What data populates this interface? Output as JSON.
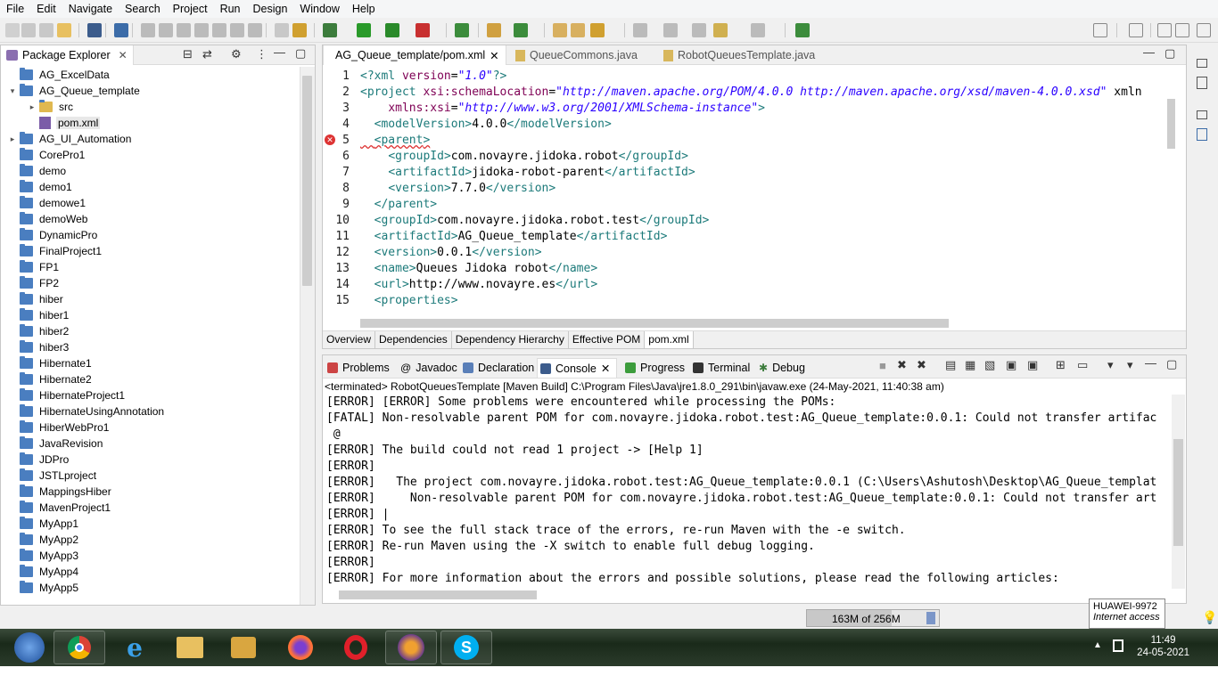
{
  "menu": [
    "File",
    "Edit",
    "Navigate",
    "Search",
    "Project",
    "Run",
    "Design",
    "Window",
    "Help"
  ],
  "package_explorer": {
    "title": "Package Explorer",
    "items": [
      {
        "label": "AG_ExcelData",
        "indent": 0,
        "arrow": ""
      },
      {
        "label": "AG_Queue_template",
        "indent": 0,
        "arrow": "▾"
      },
      {
        "label": "src",
        "indent": 1,
        "arrow": "▸"
      },
      {
        "label": "pom.xml",
        "indent": 1,
        "arrow": "",
        "file": true
      },
      {
        "label": "AG_UI_Automation",
        "indent": 0,
        "arrow": "▸"
      },
      {
        "label": "CorePro1",
        "indent": 0,
        "arrow": ""
      },
      {
        "label": "demo",
        "indent": 0,
        "arrow": ""
      },
      {
        "label": "demo1",
        "indent": 0,
        "arrow": ""
      },
      {
        "label": "demowe1",
        "indent": 0,
        "arrow": ""
      },
      {
        "label": "demoWeb",
        "indent": 0,
        "arrow": ""
      },
      {
        "label": "DynamicPro",
        "indent": 0,
        "arrow": ""
      },
      {
        "label": "FinalProject1",
        "indent": 0,
        "arrow": ""
      },
      {
        "label": "FP1",
        "indent": 0,
        "arrow": ""
      },
      {
        "label": "FP2",
        "indent": 0,
        "arrow": ""
      },
      {
        "label": "hiber",
        "indent": 0,
        "arrow": ""
      },
      {
        "label": "hiber1",
        "indent": 0,
        "arrow": ""
      },
      {
        "label": "hiber2",
        "indent": 0,
        "arrow": ""
      },
      {
        "label": "hiber3",
        "indent": 0,
        "arrow": ""
      },
      {
        "label": "Hibernate1",
        "indent": 0,
        "arrow": ""
      },
      {
        "label": "Hibernate2",
        "indent": 0,
        "arrow": ""
      },
      {
        "label": "HibernateProject1",
        "indent": 0,
        "arrow": ""
      },
      {
        "label": "HibernateUsingAnnotation",
        "indent": 0,
        "arrow": ""
      },
      {
        "label": "HiberWebPro1",
        "indent": 0,
        "arrow": ""
      },
      {
        "label": "JavaRevision",
        "indent": 0,
        "arrow": ""
      },
      {
        "label": "JDPro",
        "indent": 0,
        "arrow": ""
      },
      {
        "label": "JSTLproject",
        "indent": 0,
        "arrow": ""
      },
      {
        "label": "MappingsHiber",
        "indent": 0,
        "arrow": ""
      },
      {
        "label": "MavenProject1",
        "indent": 0,
        "arrow": ""
      },
      {
        "label": "MyApp1",
        "indent": 0,
        "arrow": ""
      },
      {
        "label": "MyApp2",
        "indent": 0,
        "arrow": ""
      },
      {
        "label": "MyApp3",
        "indent": 0,
        "arrow": ""
      },
      {
        "label": "MyApp4",
        "indent": 0,
        "arrow": ""
      },
      {
        "label": "MyApp5",
        "indent": 0,
        "arrow": ""
      }
    ]
  },
  "editor": {
    "tabs": [
      "AG_Queue_template/pom.xml",
      "QueueCommons.java",
      "RobotQueuesTemplate.java"
    ],
    "lines": [
      {
        "n": "1",
        "text": "<?xml version=\"1.0\"?>"
      },
      {
        "n": "2",
        "text": "<project xsi:schemaLocation=\"http://maven.apache.org/POM/4.0.0 http://maven.apache.org/xsd/maven-4.0.0.xsd\" xmln"
      },
      {
        "n": "3",
        "text": "    xmlns:xsi=\"http://www.w3.org/2001/XMLSchema-instance\">"
      },
      {
        "n": "4",
        "text": "  <modelVersion>4.0.0</modelVersion>"
      },
      {
        "n": "5",
        "text": "  <parent>"
      },
      {
        "n": "6",
        "text": "    <groupId>com.novayre.jidoka.robot</groupId>"
      },
      {
        "n": "7",
        "text": "    <artifactId>jidoka-robot-parent</artifactId>"
      },
      {
        "n": "8",
        "text": "    <version>7.7.0</version>"
      },
      {
        "n": "9",
        "text": "  </parent>"
      },
      {
        "n": "10",
        "text": "  <groupId>com.novayre.jidoka.robot.test</groupId>"
      },
      {
        "n": "11",
        "text": "  <artifactId>AG_Queue_template</artifactId>"
      },
      {
        "n": "12",
        "text": "  <version>0.0.1</version>"
      },
      {
        "n": "13",
        "text": "  <name>Queues Jidoka robot</name>"
      },
      {
        "n": "14",
        "text": "  <url>http://www.novayre.es</url>"
      },
      {
        "n": "15",
        "text": "  <properties>"
      }
    ],
    "bottom_tabs": [
      "Overview",
      "Dependencies",
      "Dependency Hierarchy",
      "Effective POM",
      "pom.xml"
    ]
  },
  "console": {
    "tabs": [
      "Problems",
      "Javadoc",
      "Declaration",
      "Console",
      "Progress",
      "Terminal",
      "Debug"
    ],
    "status": "<terminated> RobotQueuesTemplate [Maven Build] C:\\Program Files\\Java\\jre1.8.0_291\\bin\\javaw.exe (24-May-2021, 11:40:38 am)",
    "lines": [
      "[ERROR] [ERROR] Some problems were encountered while processing the POMs:",
      "[FATAL] Non-resolvable parent POM for com.novayre.jidoka.robot.test:AG_Queue_template:0.0.1: Could not transfer artifac",
      " @",
      "[ERROR] The build could not read 1 project -> [Help 1]",
      "[ERROR]",
      "[ERROR]   The project com.novayre.jidoka.robot.test:AG_Queue_template:0.0.1 (C:\\Users\\Ashutosh\\Desktop\\AG_Queue_templat",
      "[ERROR]     Non-resolvable parent POM for com.novayre.jidoka.robot.test:AG_Queue_template:0.0.1: Could not transfer art",
      "[ERROR] |",
      "[ERROR] To see the full stack trace of the errors, re-run Maven with the -e switch.",
      "[ERROR] Re-run Maven using the -X switch to enable full debug logging.",
      "[ERROR]",
      "[ERROR] For more information about the errors and possible solutions, please read the following articles:"
    ]
  },
  "status": {
    "heap": "163M of 256M",
    "heap_used_fraction": 0.64
  },
  "tooltip": {
    "title": "HUAWEI-9972",
    "subtitle": "Internet access"
  },
  "taskbar": {
    "time": "11:49",
    "date": "24-05-2021"
  }
}
